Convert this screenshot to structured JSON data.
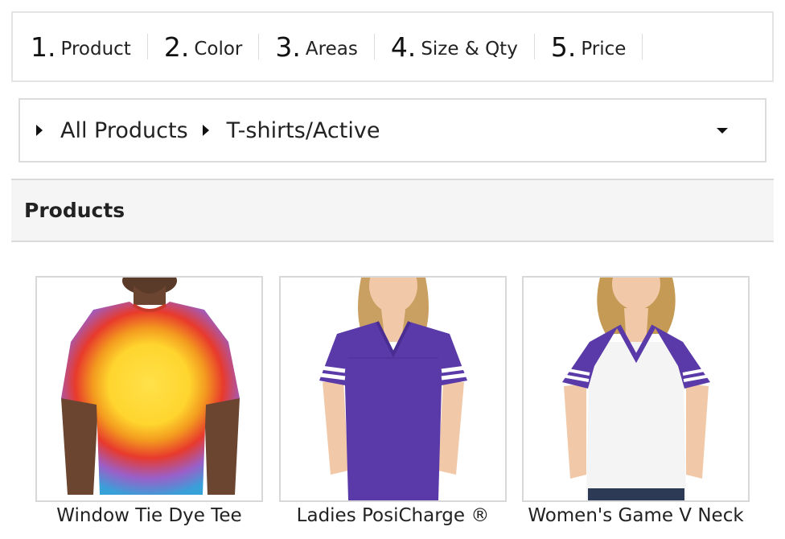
{
  "steps": [
    {
      "num": "1.",
      "label": "Product"
    },
    {
      "num": "2.",
      "label": "Color"
    },
    {
      "num": "3.",
      "label": "Areas"
    },
    {
      "num": "4.",
      "label": "Size & Qty"
    },
    {
      "num": "5.",
      "label": "Price"
    }
  ],
  "breadcrumb": {
    "items": [
      "All Products",
      "T-shirts/Active"
    ],
    "dropdown_icon": "caret-down-icon"
  },
  "products": {
    "title": "Products",
    "items": [
      {
        "name": "Window Tie Dye Tee",
        "image": "tie-dye-tshirt-image"
      },
      {
        "name": "Ladies PosiCharge ®",
        "image": "purple-jersey-image"
      },
      {
        "name": "Women's Game V Neck",
        "image": "raglan-v-neck-image"
      }
    ]
  },
  "colors": {
    "border": "#dcdcdc",
    "header_bg": "#f5f5f5",
    "purple": "#5a3aa8"
  }
}
